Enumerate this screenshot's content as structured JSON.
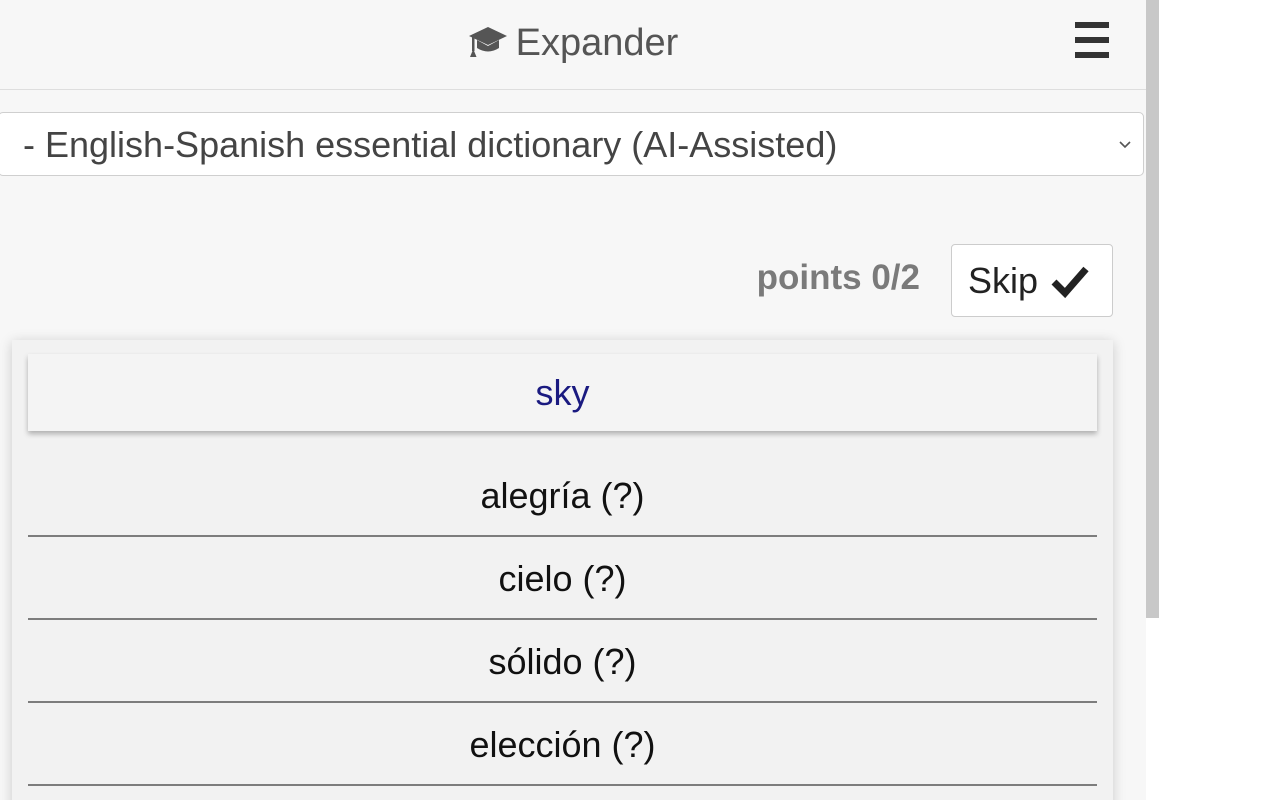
{
  "header": {
    "title": "Expander",
    "logo_icon": "graduation-cap-icon",
    "menu_icon": "hamburger-menu-icon"
  },
  "dictionary_select": {
    "selected": "- English-Spanish essential dictionary (AI-Assisted)"
  },
  "score": {
    "text": "points 0/2"
  },
  "skip_button": {
    "label": "Skip",
    "icon": "checkmark-icon"
  },
  "quiz": {
    "question": "sky",
    "options": [
      "alegría (?)",
      "cielo (?)",
      "sólido (?)",
      "elección (?)"
    ]
  },
  "colors": {
    "question_text": "#1a1a80",
    "header_text": "#555555",
    "points_text": "#7a7a7a"
  }
}
